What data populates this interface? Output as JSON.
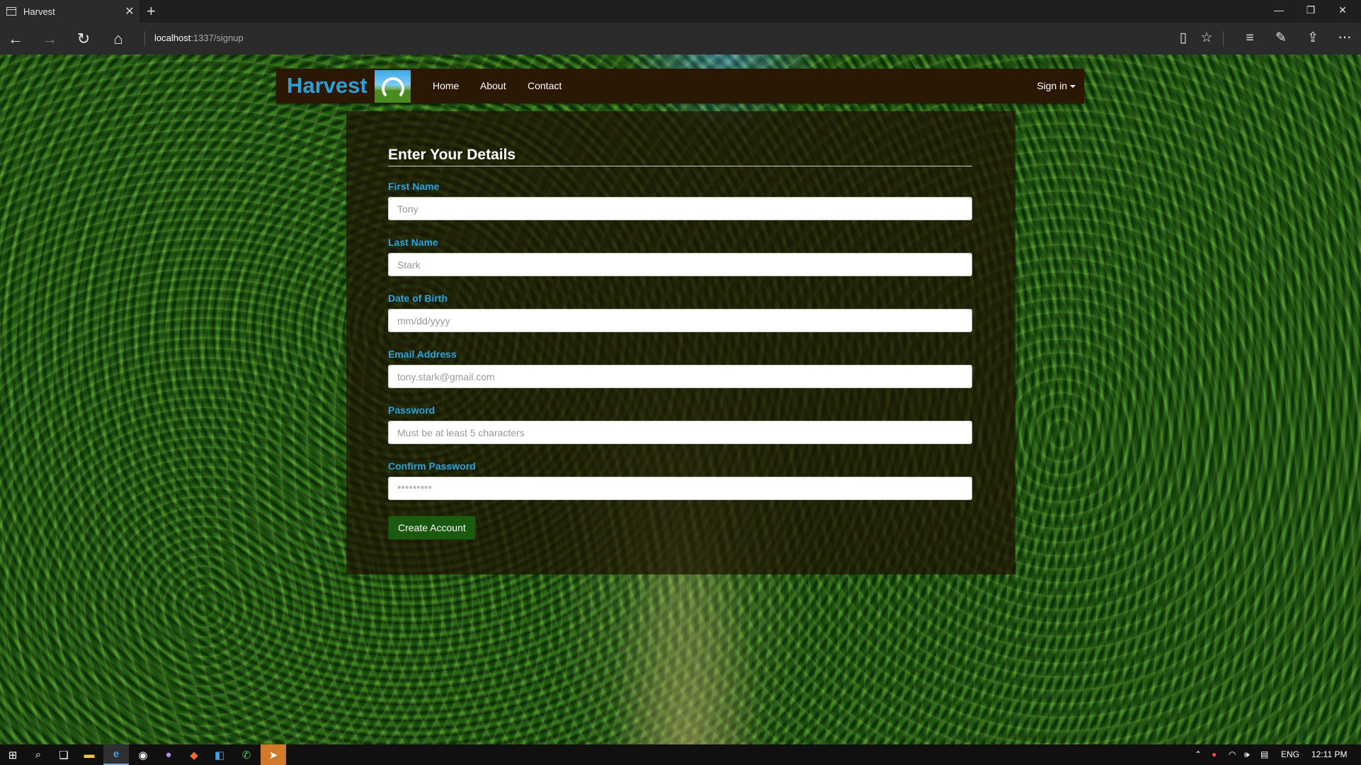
{
  "browser": {
    "tab_title": "Harvest",
    "url_host": "localhost",
    "url_path": ":1337/signup",
    "accent": "#2b2b2b"
  },
  "site": {
    "brand": "Harvest",
    "brand_color": "#2aa0d8",
    "nav": [
      "Home",
      "About",
      "Contact"
    ],
    "signin_label": "Sign in",
    "navbar_bg": "#2b1804"
  },
  "form": {
    "title": "Enter Your Details",
    "label_color": "#2ea3dc",
    "fields": [
      {
        "label": "First Name",
        "placeholder": "Tony",
        "type": "text"
      },
      {
        "label": "Last Name",
        "placeholder": "Stark",
        "type": "text"
      },
      {
        "label": "Date of Birth",
        "placeholder": "mm/dd/yyyy",
        "type": "date"
      },
      {
        "label": "Email Address",
        "placeholder": "tony.stark@gmail.com",
        "type": "email"
      },
      {
        "label": "Password",
        "placeholder": "Must be at least 5 characters",
        "type": "password"
      },
      {
        "label": "Confirm Password",
        "placeholder": "*********",
        "type": "password"
      }
    ],
    "submit_label": "Create Account",
    "submit_color": "#1a5a0f"
  },
  "taskbar": {
    "language": "ENG",
    "clock": "12:11 PM"
  }
}
